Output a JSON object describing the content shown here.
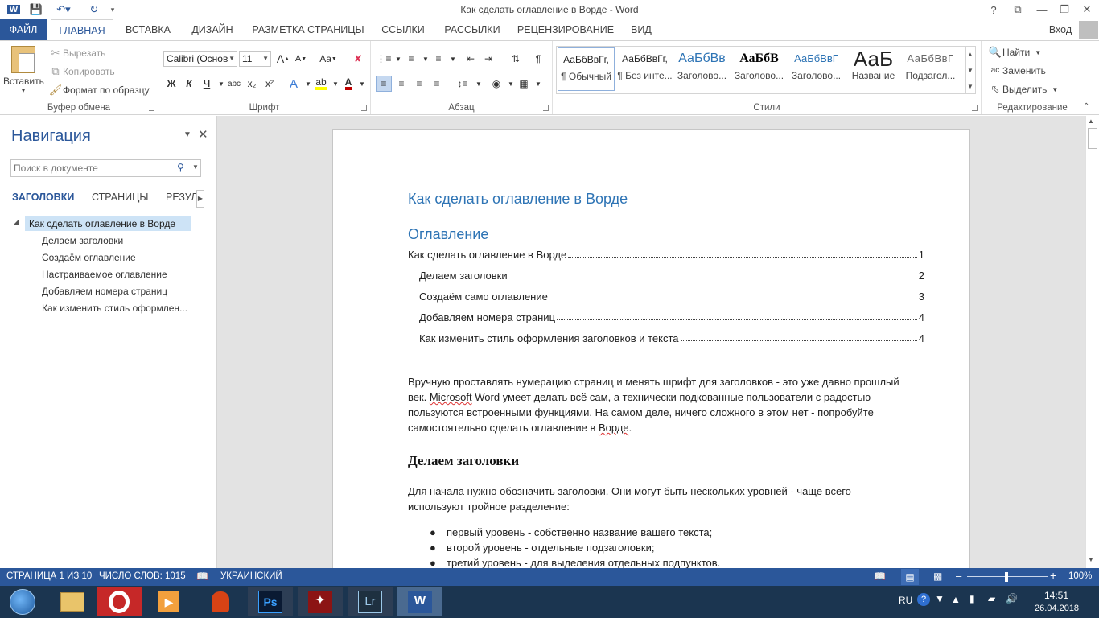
{
  "titlebar": {
    "title": "Как сделать оглавление в Ворде - Word",
    "help": "?",
    "word_icon": "W"
  },
  "tabs": {
    "file": "ФАЙЛ",
    "home": "ГЛАВНАЯ",
    "insert": "ВСТАВКА",
    "design": "ДИЗАЙН",
    "layout": "РАЗМЕТКА СТРАНИЦЫ",
    "refs": "ССЫЛКИ",
    "mailings": "РАССЫЛКИ",
    "review": "РЕЦЕНЗИРОВАНИЕ",
    "view": "ВИД",
    "signin": "Вход"
  },
  "clipboard": {
    "paste": "Вставить",
    "cut": "Вырезать",
    "copy": "Копировать",
    "format": "Формат по образцу",
    "label": "Буфер обмена"
  },
  "font": {
    "name": "Calibri (Основ",
    "size": "11",
    "label": "Шрифт",
    "bold": "Ж",
    "italic": "К",
    "underline": "Ч",
    "strike": "abc",
    "sub": "x₂",
    "sup": "x²",
    "grow": "A",
    "shrink": "A",
    "case": "Aa",
    "color_hex": "#c00000",
    "highlight_hex": "#ffff00"
  },
  "paragraph": {
    "label": "Абзац"
  },
  "styles": {
    "label": "Стили",
    "items": [
      {
        "preview": "АаБбВвГг,",
        "name": "¶ Обычный"
      },
      {
        "preview": "АаБбВвГг,",
        "name": "¶ Без инте..."
      },
      {
        "preview": "АаБбВв",
        "name": "Заголово..."
      },
      {
        "preview": "АаБбВ",
        "name": "Заголово..."
      },
      {
        "preview": "АаБбВвГ",
        "name": "Заголово..."
      },
      {
        "preview": "АаБ",
        "name": "Название"
      },
      {
        "preview": "АаБбВвГ",
        "name": "Подзагол..."
      }
    ]
  },
  "editing": {
    "find": "Найти",
    "replace": "Заменить",
    "select": "Выделить",
    "label": "Редактирование"
  },
  "nav": {
    "title": "Навигация",
    "search_placeholder": "Поиск в документе",
    "tabs": {
      "headings": "ЗАГОЛОВКИ",
      "pages": "СТРАНИЦЫ",
      "results": "РЕЗУЛ"
    },
    "root": "Как сделать оглавление в Ворде",
    "items": [
      "Делаем заголовки",
      "Создаём оглавление",
      "Настраиваемое оглавление",
      "Добавляем номера страниц",
      "Как изменить стиль оформлен..."
    ]
  },
  "doc": {
    "title": "Как сделать оглавление в Ворде",
    "toc_heading": "Оглавление",
    "toc": [
      {
        "text": "Как сделать оглавление в Ворде",
        "page": "1"
      },
      {
        "text": "Делаем заголовки",
        "page": "2"
      },
      {
        "text": "Создаём само оглавление",
        "page": "3"
      },
      {
        "text": "Добавляем номера страниц",
        "page": "4"
      },
      {
        "text": "Как изменить стиль оформления заголовков и текста",
        "page": "4"
      }
    ],
    "para1_l1": "Вручную проставлять нумерацию страниц и менять шрифт для заголовков - это уже давно прошлый",
    "para1_l2a": "век. ",
    "para1_l2b": "Microsoft",
    "para1_l2c": " Word умеет делать всё сам, а технически подкованные пользователи с радостью",
    "para1_l3": "пользуются встроенными функциями. На самом деле, ничего сложного в этом нет - попробуйте",
    "para1_l4a": "самостоятельно сделать оглавление в ",
    "para1_l4b": "Ворде",
    "para1_l4c": ".",
    "h2": "Делаем заголовки",
    "para2_l1": "Для начала нужно обозначить заголовки. Они могут быть нескольких уровней - чаще всего",
    "para2_l2": "используют тройное разделение:",
    "bullets": [
      "первый уровень - собственно название вашего текста;",
      "второй уровень - отдельные подзаголовки;",
      "третий уровень - для выделения отдельных подпунктов."
    ]
  },
  "status": {
    "page": "СТРАНИЦА 1 ИЗ 10",
    "words": "ЧИСЛО СЛОВ: 1015",
    "lang": "УКРАИНСКИЙ",
    "zoom": "100%"
  },
  "taskbar": {
    "lang": "RU",
    "time": "14:51",
    "date": "26.04.2018"
  },
  "colors": {
    "accent": "#2b579a",
    "heading": "#2e74b5"
  }
}
